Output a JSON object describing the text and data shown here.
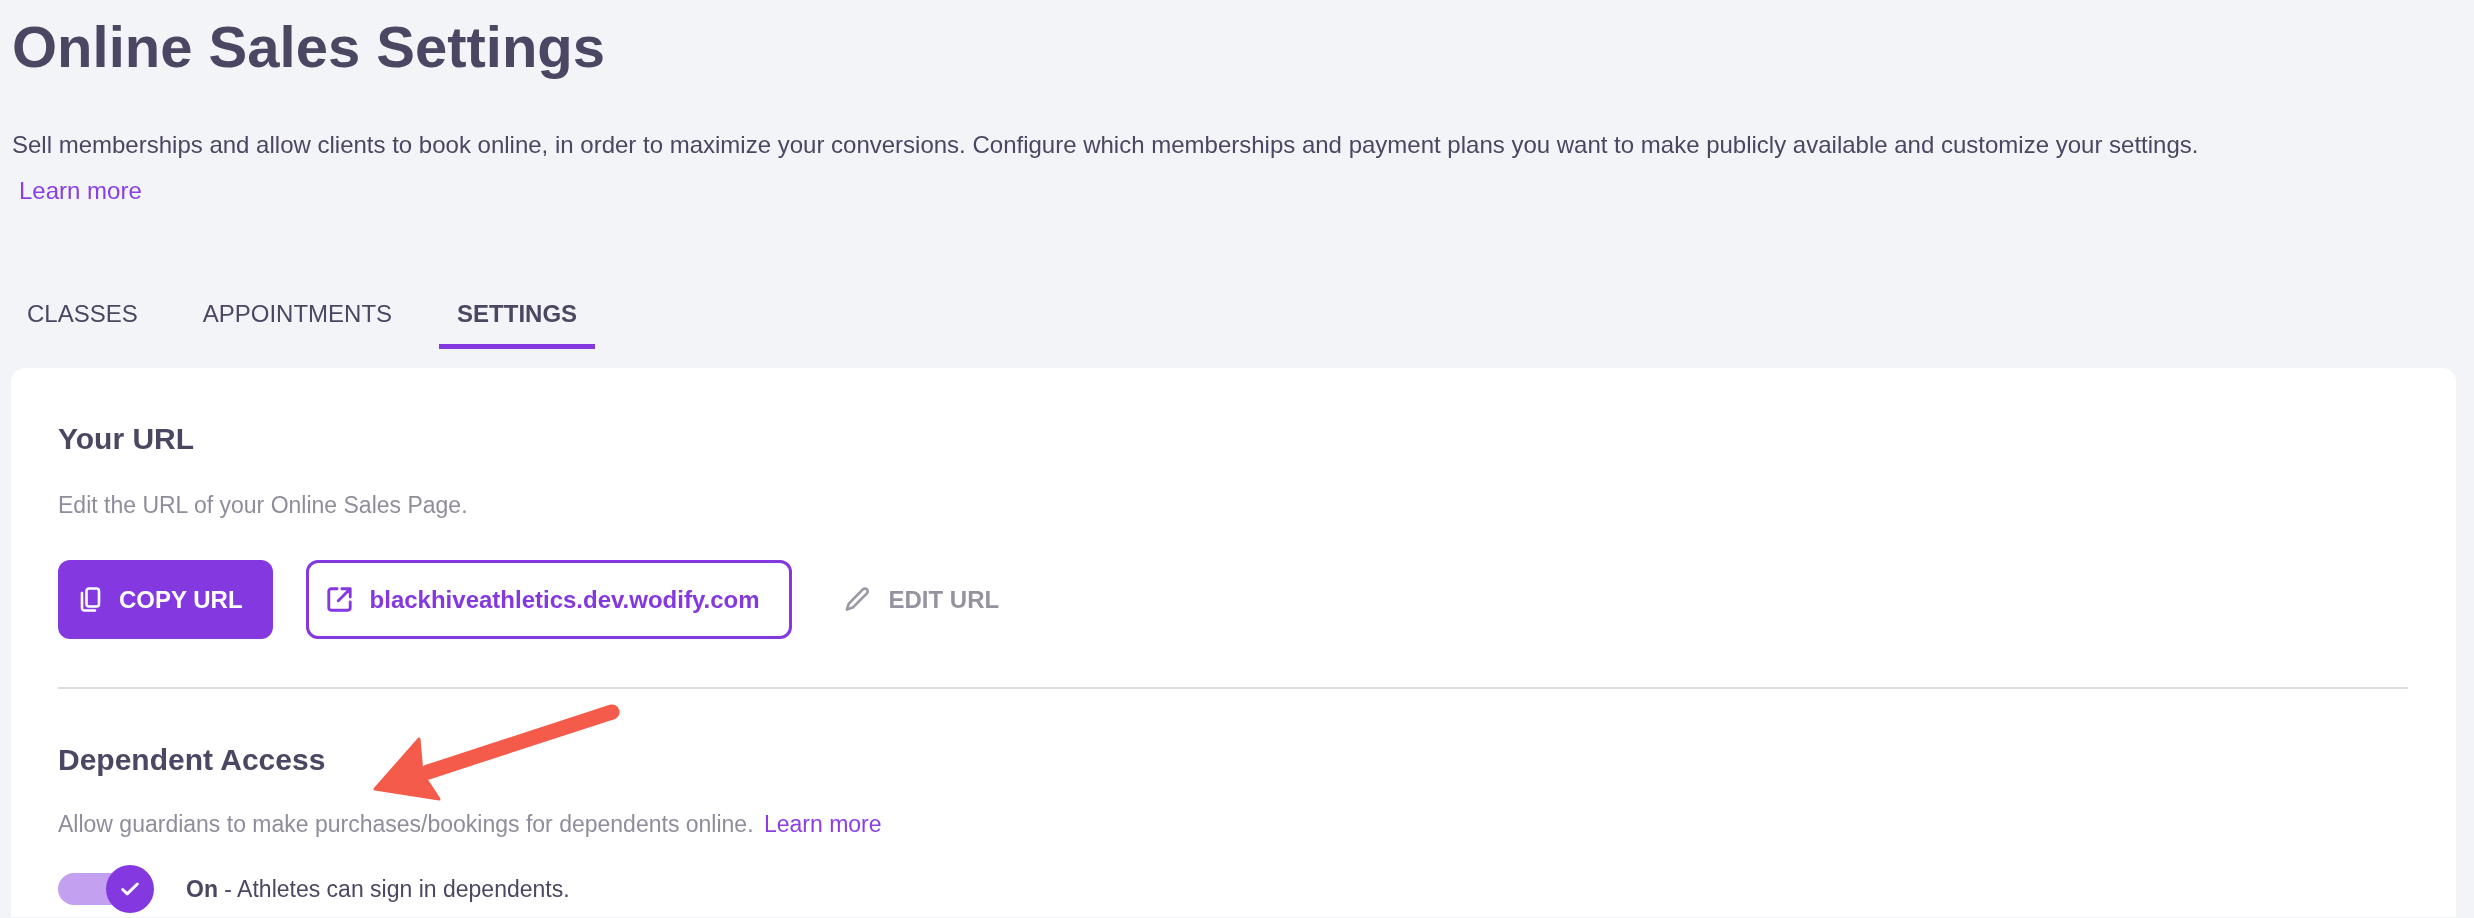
{
  "page": {
    "title": "Online Sales Settings",
    "description": "Sell memberships and allow clients to book online, in order to maximize your conversions. Configure which memberships and payment plans you want to make publicly available and customize your settings.",
    "learn_more": "Learn more"
  },
  "tabs": [
    {
      "label": "CLASSES",
      "selected": false
    },
    {
      "label": "APPOINTMENTS",
      "selected": false
    },
    {
      "label": "SETTINGS",
      "selected": true
    }
  ],
  "your_url": {
    "heading": "Your URL",
    "description": "Edit the URL of your Online Sales Page.",
    "buttons": [
      {
        "kind": "primary",
        "label": "COPY URL"
      },
      {
        "kind": "link",
        "label": "blackhiveathletics.dev.wodify.com"
      },
      {
        "kind": "text",
        "label": "EDIT URL"
      }
    ]
  },
  "dependent_access": {
    "heading": "Dependent Access",
    "description": "Allow guardians to make purchases/bookings for dependents online.",
    "learn_more": "Learn more",
    "toggle": {
      "on": true,
      "label": "**On** - Athletes can sign in dependents."
    }
  }
}
